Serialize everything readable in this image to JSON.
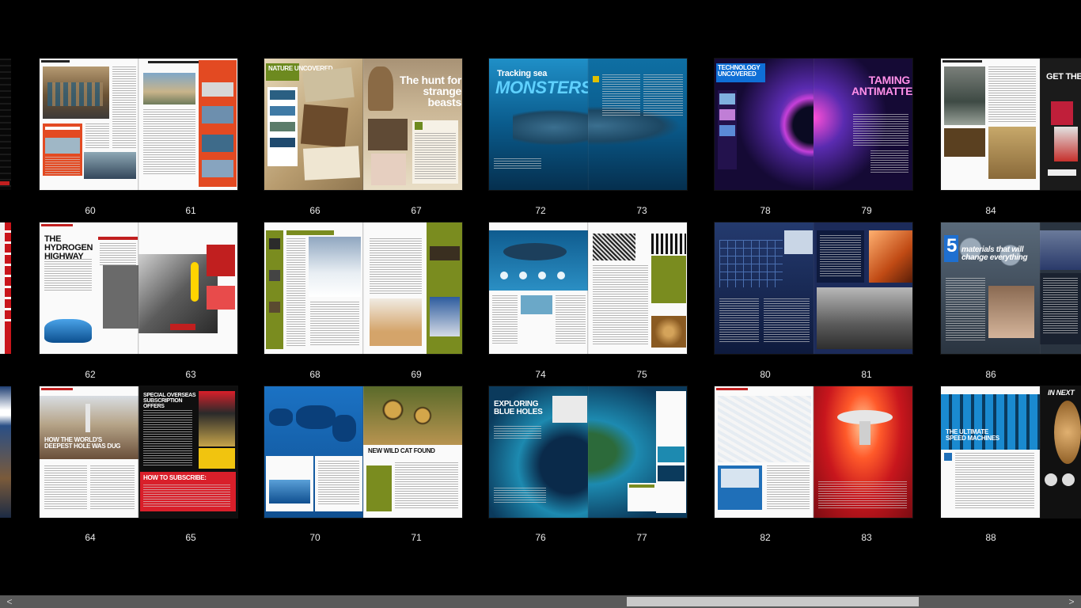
{
  "app": {
    "view": "page-thumbnails"
  },
  "spreads": [
    {
      "left_page": "60",
      "right_page": "61",
      "theme": "industry",
      "headline": ""
    },
    {
      "left_page": "66",
      "right_page": "67",
      "theme": "nature",
      "headline": "The hunt for strange beasts",
      "section": "NATURE UNCOVERED"
    },
    {
      "left_page": "72",
      "right_page": "73",
      "theme": "sea",
      "headline": "MONSTERS",
      "kicker": "Tracking sea"
    },
    {
      "left_page": "78",
      "right_page": "79",
      "theme": "antimatter",
      "headline": "TAMING ANTIMATTER",
      "section": "TECHNOLOGY UNCOVERED"
    },
    {
      "left_page": "84",
      "right_page": "",
      "theme": "lab-ad",
      "headline": "GET THE"
    },
    {
      "left_page": "62",
      "right_page": "63",
      "theme": "hydrogen",
      "headline": "THE HYDROGEN HIGHWAY"
    },
    {
      "left_page": "68",
      "right_page": "69",
      "theme": "animals",
      "headline": ""
    },
    {
      "left_page": "74",
      "right_page": "75",
      "theme": "shark",
      "headline": ""
    },
    {
      "left_page": "80",
      "right_page": "81",
      "theme": "lab",
      "headline": ""
    },
    {
      "left_page": "86",
      "right_page": "",
      "theme": "materials",
      "headline": "materials that will change everything",
      "big_number": "5"
    },
    {
      "left_page": "64",
      "right_page": "65",
      "theme": "subscribe",
      "headline": "HOW THE WORLD'S DEEPEST HOLE WAS DUG",
      "right_headline": "SPECIAL OVERSEAS SUBSCRIPTION OFFERS",
      "cta": "HOW TO SUBSCRIBE:"
    },
    {
      "left_page": "70",
      "right_page": "71",
      "theme": "wildcat",
      "headline": "NEW WILD CAT FOUND"
    },
    {
      "left_page": "76",
      "right_page": "77",
      "theme": "blueholes",
      "headline": "EXPLORING BLUE HOLES"
    },
    {
      "left_page": "82",
      "right_page": "83",
      "theme": "starship",
      "headline": ""
    },
    {
      "left_page": "88",
      "right_page": "",
      "theme": "supercomputer",
      "headline": "THE ULTIMATE SPEED MACHINES",
      "right_headline": "IN NEXT"
    }
  ],
  "scrollbar": {
    "left_arrow": "<",
    "right_arrow": ">",
    "thumb_start_fraction": 0.58,
    "thumb_length_fraction": 0.27
  }
}
